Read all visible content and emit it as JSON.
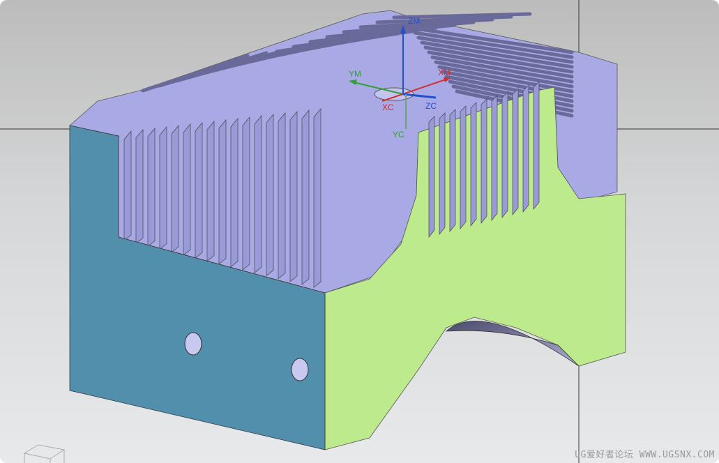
{
  "viewport": {
    "axes": {
      "zm": "ZM",
      "ym": "YM",
      "xm": "XM",
      "xc": "XC",
      "zc": "ZC",
      "yc": "YC"
    },
    "colors": {
      "top_face": "#a9a9e6",
      "front_face": "#528fac",
      "side_face": "#bdea8c",
      "x_axis": "#d03030",
      "y_axis": "#30a030",
      "z_axis": "#2050d0"
    },
    "watermark": "UG爱好者论坛 WWW.UGSNX.COM"
  }
}
